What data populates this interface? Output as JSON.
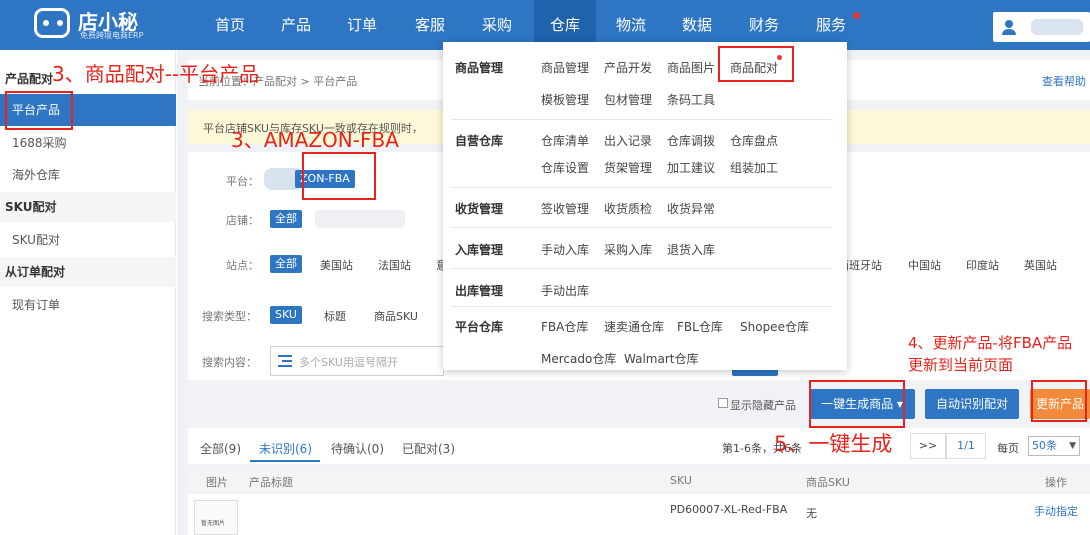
{
  "header": {
    "logo_name": "店小秘",
    "logo_tagline": "免费跨境电商ERP",
    "nav": [
      {
        "label": "首页"
      },
      {
        "label": "产品"
      },
      {
        "label": "订单"
      },
      {
        "label": "客服"
      },
      {
        "label": "采购"
      },
      {
        "label": "仓库"
      },
      {
        "label": "物流"
      },
      {
        "label": "数据"
      },
      {
        "label": "财务"
      },
      {
        "label": "服务"
      }
    ]
  },
  "sidebar": {
    "sections": [
      {
        "title": "产品配对",
        "items": [
          {
            "label": "平台产品"
          },
          {
            "label": "1688采购"
          },
          {
            "label": "海外仓库"
          }
        ]
      },
      {
        "title": "SKU配对",
        "items": [
          {
            "label": "SKU配对"
          }
        ]
      },
      {
        "title": "从订单配对",
        "items": [
          {
            "label": "现有订单"
          }
        ]
      }
    ]
  },
  "breadcrumb": "当前位置：产品配对 > 平台产品",
  "help_link": "查看帮助",
  "notice": "平台店铺SKU与库存SKU一致或存在规则时，",
  "filters": {
    "platform_label": "平台：",
    "platform_value": "ZON-FBA",
    "store_label": "店铺：",
    "store_all": "全部",
    "site_label": "站点：",
    "sites_left": [
      "全部",
      "美国站",
      "法国站",
      "意"
    ],
    "sites_right": [
      "西班牙站",
      "中国站",
      "印度站",
      "英国站"
    ],
    "search_type_label": "搜索类型：",
    "search_types": [
      "SKU",
      "标题",
      "商品SKU"
    ],
    "search_content_label": "搜索内容：",
    "search_placeholder": "多个SKU用逗号隔开"
  },
  "dropdown_menu": {
    "groups": [
      {
        "title": "商品管理",
        "rows": [
          [
            "商品管理",
            "产品开发",
            "商品图片",
            "商品配对"
          ],
          [
            "模板管理",
            "包材管理",
            "条码工具"
          ]
        ]
      },
      {
        "title": "自营仓库",
        "rows": [
          [
            "仓库清单",
            "出入记录",
            "仓库调拨",
            "仓库盘点"
          ],
          [
            "仓库设置",
            "货架管理",
            "加工建议",
            "组装加工"
          ]
        ]
      },
      {
        "title": "收货管理",
        "rows": [
          [
            "签收管理",
            "收货质检",
            "收货异常"
          ]
        ]
      },
      {
        "title": "入库管理",
        "rows": [
          [
            "手动入库",
            "采购入库",
            "退货入库"
          ]
        ]
      },
      {
        "title": "出库管理",
        "rows": [
          [
            "手动出库"
          ]
        ]
      },
      {
        "title": "平台仓库",
        "rows": [
          [
            "FBA仓库",
            "速卖通仓库",
            "FBL仓库",
            "Shopee仓库"
          ],
          [
            "Mercado仓库",
            "Walmart仓库"
          ]
        ]
      }
    ]
  },
  "actions": {
    "hide_products": "显示隐藏产品",
    "generate": "一键生成商品",
    "auto_match": "自动识别配对",
    "update": "更新产品"
  },
  "tabs": [
    {
      "label": "全部(9)"
    },
    {
      "label": "未识别(6)"
    },
    {
      "label": "待确认(0)"
    },
    {
      "label": "已配对(3)"
    }
  ],
  "pagination": {
    "range": "第1-6条，共6条",
    "next": ">>",
    "page": "1/1",
    "per_page_label": "每页",
    "per_page_value": "50条"
  },
  "table": {
    "headers": [
      "图片",
      "产品标题",
      "SKU",
      "商品SKU",
      "操作"
    ],
    "rows": [
      {
        "img_text": "暂无图片",
        "title": "",
        "sku": "PD60007-XL-Red-FBA",
        "product_sku": "无",
        "action": "手动指定"
      }
    ]
  },
  "annotations": {
    "a1": "3、商品配对--平台产品",
    "a2": "3、AMAZON-FBA",
    "a3": "4、更新产品-将FBA产品更新到当前页面",
    "a4": "5、一键生成"
  },
  "colors": {
    "primary": "#2e76c4",
    "annotation": "#e8231b",
    "notice_bg": "#fdf9d8"
  }
}
